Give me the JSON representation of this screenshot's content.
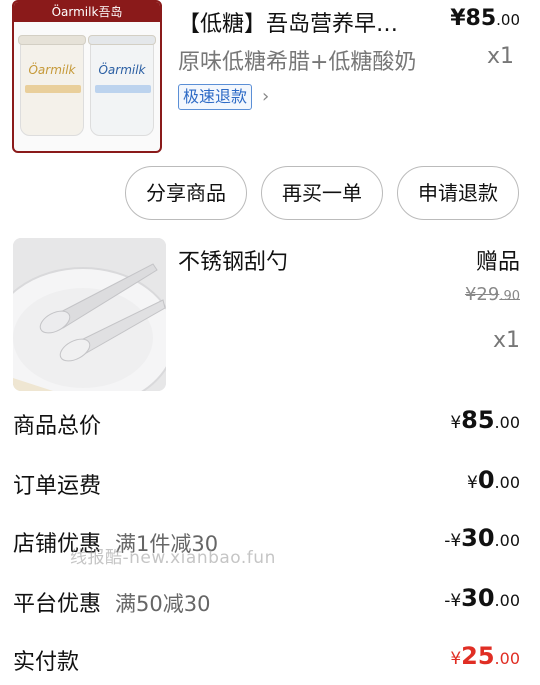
{
  "product_main": {
    "brand_bar": "Öarmilk吾岛",
    "cup_left_label": "Öarmilk",
    "cup_right_label": "Öarmilk",
    "title": "【低糖】吾岛营养早…",
    "price_int": "¥85",
    "price_dec": ".00",
    "spec": "原味低糖希腊+低糖酸奶",
    "quantity": "x1",
    "refund_tag": "极速退款",
    "chevron": "›"
  },
  "actions": {
    "share_label": "分享商品",
    "rebuy_label": "再买一单",
    "refund_label": "申请退款"
  },
  "product_gift": {
    "title": "不锈钢刮勺",
    "gift_label": "赠品",
    "original_price_int": "¥29",
    "original_price_dec": ".90",
    "quantity": "x1"
  },
  "summary": {
    "goods_total_label": "商品总价",
    "goods_total_sym": "¥",
    "goods_total_int": "85",
    "goods_total_dec": ".00",
    "shipping_label": "订单运费",
    "shipping_sym": "¥",
    "shipping_int": "0",
    "shipping_dec": ".00",
    "store_discount_label": "店铺优惠",
    "store_discount_promo": "满1件减30",
    "store_discount_sym": "-¥",
    "store_discount_int": "30",
    "store_discount_dec": ".00",
    "platform_discount_label": "平台优惠",
    "platform_discount_promo": "满50减30",
    "platform_discount_sym": "-¥",
    "platform_discount_int": "30",
    "platform_discount_dec": ".00",
    "paid_label": "实付款",
    "paid_sym": "¥",
    "paid_int": "25",
    "paid_dec": ".00"
  },
  "watermark": "线报酷-new.xianbao.fun",
  "colors": {
    "accent_red": "#e02e24",
    "refund_tag_blue": "#2e6bc6",
    "thumb_border": "#8a1a1a"
  }
}
